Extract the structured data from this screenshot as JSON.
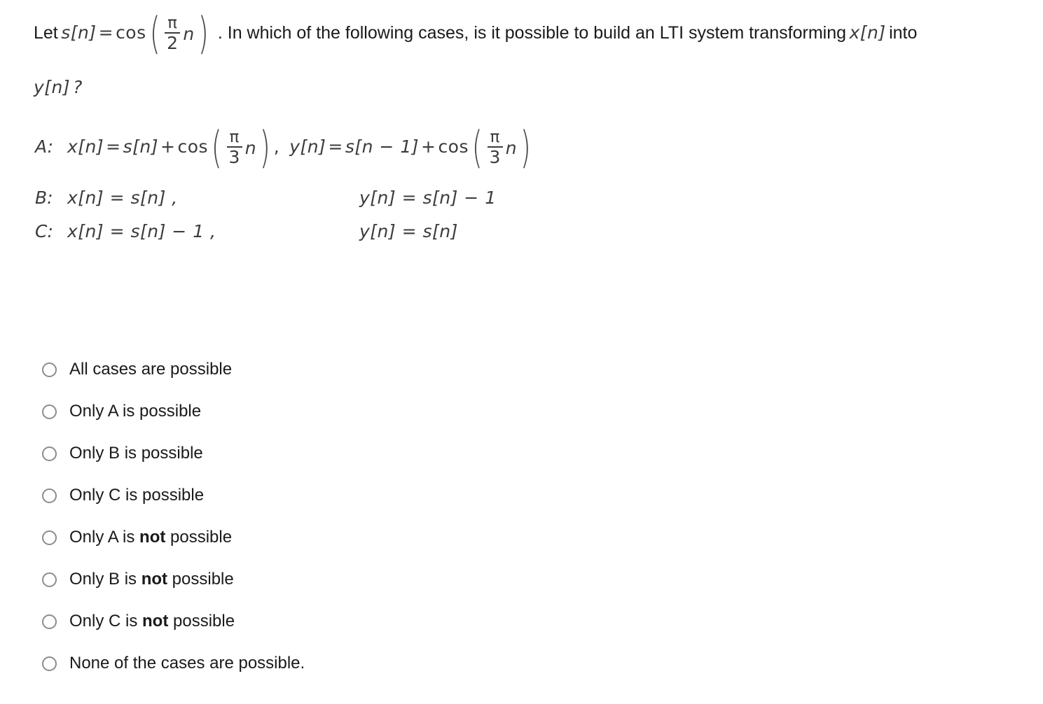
{
  "question": {
    "intro_text_1": "Let",
    "definition": {
      "lhs": "s[n]",
      "equals": "=",
      "fn": "cos",
      "frac_numer": "π",
      "frac_denom": "2",
      "var": "n"
    },
    "intro_text_2": ". In which of the following cases, is it possible to build an LTI system transforming",
    "input_signal": "x[n]",
    "intro_text_3": "into",
    "output_signal_question": "y[n]",
    "question_mark": "?"
  },
  "cases": [
    {
      "label": "A:",
      "x_def": {
        "lhs": "x[n]",
        "equals": "=",
        "term1": "s[n]",
        "plus": "+",
        "fn": "cos",
        "frac_numer": "π",
        "frac_denom": "3",
        "var": "n",
        "comma": ","
      },
      "y_def": {
        "lhs": "y[n]",
        "equals": "=",
        "term1": "s[n − 1]",
        "plus": "+",
        "fn": "cos",
        "frac_numer": "π",
        "frac_denom": "3",
        "var": "n"
      }
    },
    {
      "label": "B:",
      "x_def": {
        "text": "x[n] = s[n] ,"
      },
      "y_def": {
        "text": "y[n] = s[n] − 1"
      }
    },
    {
      "label": "C:",
      "x_def": {
        "text": "x[n] = s[n] − 1 ,"
      },
      "y_def": {
        "text": "y[n] = s[n]"
      }
    }
  ],
  "options": [
    {
      "pre": "All cases are possible",
      "bold": "",
      "post": ""
    },
    {
      "pre": "Only A is possible",
      "bold": "",
      "post": ""
    },
    {
      "pre": "Only B is possible",
      "bold": "",
      "post": ""
    },
    {
      "pre": "Only C is possible",
      "bold": "",
      "post": ""
    },
    {
      "pre": "Only A is ",
      "bold": "not",
      "post": " possible"
    },
    {
      "pre": "Only B is ",
      "bold": "not",
      "post": " possible"
    },
    {
      "pre": "Only C is ",
      "bold": "not",
      "post": " possible"
    },
    {
      "pre": "None of the cases are possible.",
      "bold": "",
      "post": ""
    }
  ],
  "colors": {
    "background": "#ffffff",
    "text": "#1a1a1a",
    "math_text": "#3c3c3c",
    "radio_border": "#8c8c8c"
  }
}
